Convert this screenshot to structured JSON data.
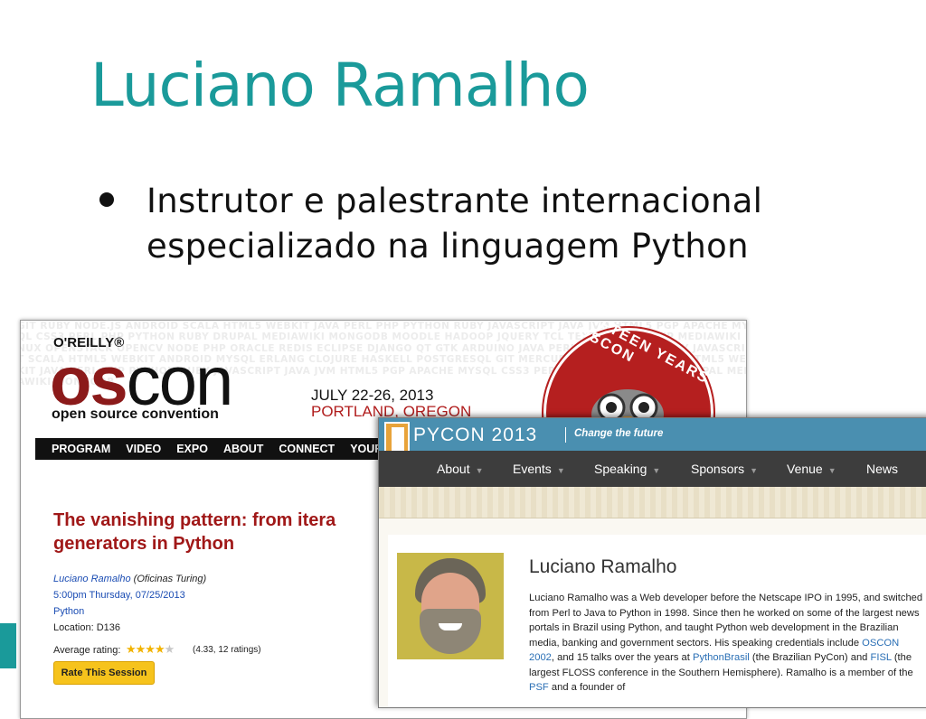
{
  "slide": {
    "title": "Luciano Ramalho",
    "bullet_line1": "Instrutor e palestrante internacional",
    "bullet_line2": "especializado na linguagem Python"
  },
  "oscon": {
    "background_words": "GIT RUBY NODE.JS ANDROID SCALA HTML5 WEBKIT JAVA PERL PHP PYTHON RUBY JAVASCRIPT JAVA JVM HTML5 PGP APACHE MYSQL CSS3 PERL PHP PYTHON RUBY DRUPAL MEDIAWIKI MONGODB MOODLE HADOOP JQUERY TCL TEXTPATTERN PHP MEDIAWIKI LINUX OPENSTACK OPENCV NODE PHP ORACLE REDIS ECLIPSE DJANGO QT GTK ARDUINO JAVA PERL PHP PYTHON RUBY JAVASCRIPT SCALA HTML5 WEBKIT ANDROID MYSQL ERLANG CLOJURE HASKELL POSTGRESQL GIT MERCURIAL ANDROID SCALA HTML5 WEBKIT JAVA PERL PHP PYTHON RUBY JAVASCRIPT JAVA JVM HTML5 PGP APACHE MYSQL CSS3 PERL PHP PYTHON RUBY DRUPAL MEDIAWIKI MONGODB",
    "brand": "O'REILLY®",
    "logo_os": "os",
    "logo_con": "con",
    "subtitle": "open source convention",
    "date": "JULY 22-26, 2013",
    "place": "PORTLAND, OREGON",
    "badge_text": "FIFTEEN YEARS OF OSCON",
    "nav": [
      "PROGRAM",
      "VIDEO",
      "EXPO",
      "ABOUT",
      "CONNECT",
      "YOUR A"
    ],
    "session_title": "The vanishing pattern: from itera\ngenerators in Python",
    "speaker_name": "Luciano Ramalho",
    "speaker_org": " (Oficinas Turing)",
    "time": "5:00pm Thursday, 07/25/2013",
    "track": "Python",
    "location": "Location: D136",
    "rating_label": "Average rating:",
    "rating_stars": "★★★★",
    "rating_empty_star": "★",
    "rating_value": 4.33,
    "rating_text": "(4.33, 12 ratings)",
    "rate_button": "Rate This Session"
  },
  "pycon": {
    "site_name": "PYCON 2013",
    "tagline": "Change the future",
    "nav": [
      "About",
      "Events",
      "Speaking",
      "Sponsors",
      "Venue",
      "News"
    ],
    "speaker_name": "Luciano Ramalho",
    "bio_part1": "Luciano Ramalho was a Web developer before the Netscape IPO in 1995, and switched from Perl to Java to Python in 1998. Since then he worked on some of the largest news portals in Brazil using Python, and taught Python web development in the Brazilian media, banking and government sectors. His speaking credentials include ",
    "bio_link1": "OSCON 2002",
    "bio_part2": ", and 15 talks over the years at ",
    "bio_link2": "PythonBrasil",
    "bio_part3": " (the Brazilian PyCon) and ",
    "bio_link3": "FISL",
    "bio_part4": " (the largest FLOSS conference in the Southern Hemisphere). Ramalho is a member of the ",
    "bio_link4": "PSF",
    "bio_part5": " and a founder of"
  },
  "colors": {
    "title_teal": "#1a9a9a",
    "oscon_red": "#8b1a1a",
    "pycon_blue": "#4a8fb0",
    "link_blue": "#1a4cb3"
  }
}
